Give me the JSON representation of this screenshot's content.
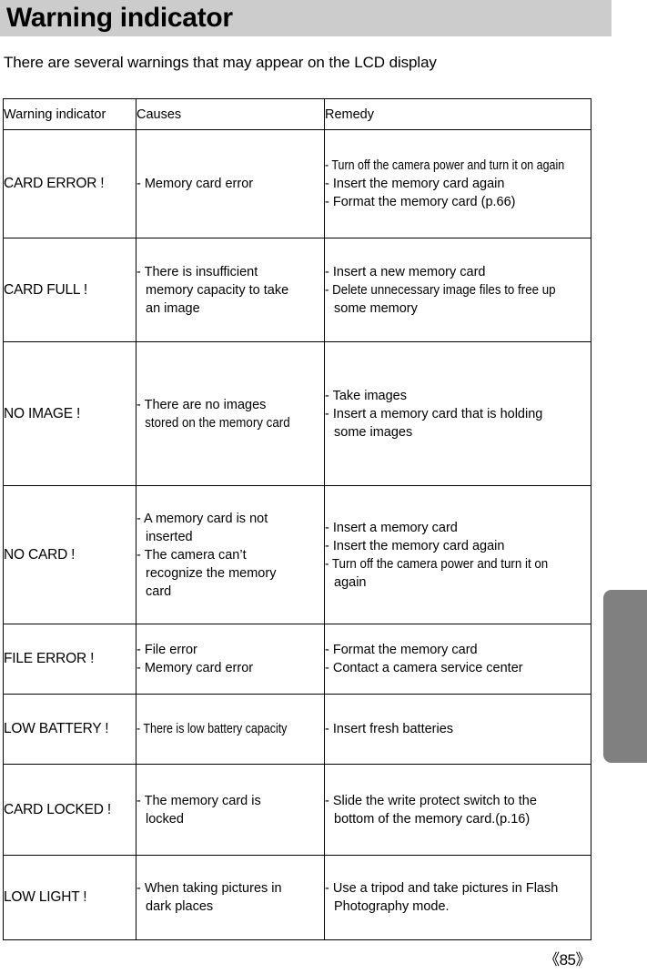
{
  "page": {
    "title": "Warning indicator",
    "subtitle": "There are several warnings that may appear on the LCD display",
    "page_number": "《85》",
    "accent_header_color": "#cccccc",
    "side_tab_color": "#808080"
  },
  "table": {
    "columns": [
      "Warning indicator",
      "Causes",
      "Remedy"
    ],
    "rows": [
      {
        "indicator": "CARD ERROR !",
        "causes": [
          "- Memory card error"
        ],
        "remedy": [
          "- Turn off the camera power and turn it on again",
          "- Insert the memory card again",
          "- Format the memory card (p.66)"
        ]
      },
      {
        "indicator": "CARD FULL !",
        "causes": [
          "- There is insufficient",
          "memory capacity to take",
          "an image"
        ],
        "remedy": [
          "- Insert a new memory card",
          "- Delete unnecessary image files to free up",
          "some memory"
        ]
      },
      {
        "indicator": "NO IMAGE !",
        "causes": [
          "- There are no images",
          "stored on the memory card"
        ],
        "remedy": [
          "- Take images",
          "- Insert a memory card that is holding",
          "some images"
        ]
      },
      {
        "indicator": "NO CARD !",
        "causes": [
          "- A memory card is not",
          "inserted",
          "- The camera can’t",
          "recognize the memory",
          "card"
        ],
        "remedy": [
          "- Insert a memory card",
          "- Insert the memory card again",
          "- Turn off the camera power and turn it on",
          "again"
        ]
      },
      {
        "indicator": "FILE ERROR !",
        "causes": [
          "- File error",
          "- Memory card error"
        ],
        "remedy": [
          "- Format the memory card",
          "- Contact a camera service center"
        ]
      },
      {
        "indicator": "LOW BATTERY !",
        "causes": [
          "- There is low battery capacity"
        ],
        "remedy": [
          "- Insert fresh batteries"
        ]
      },
      {
        "indicator": "CARD LOCKED !",
        "causes": [
          "- The memory card is",
          "locked"
        ],
        "remedy": [
          "- Slide the write protect switch to the",
          "bottom of the  memory card.(p.16)"
        ]
      },
      {
        "indicator": "LOW LIGHT !",
        "causes": [
          "- When taking pictures in",
          "dark places"
        ],
        "remedy": [
          "- Use a tripod and take pictures in Flash",
          "Photography mode."
        ]
      }
    ]
  }
}
